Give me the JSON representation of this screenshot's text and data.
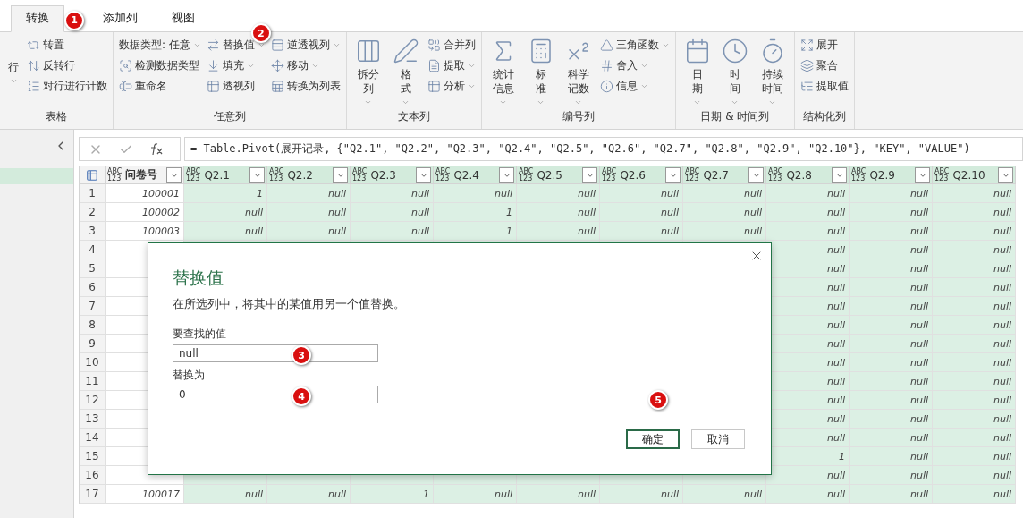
{
  "ribbon_tabs": [
    {
      "label": "转换",
      "selected": true,
      "marker": "1"
    },
    {
      "label": "添加列",
      "selected": false
    },
    {
      "label": "视图",
      "selected": false
    }
  ],
  "ribbon_groups": [
    {
      "label": "表格",
      "large": [
        {
          "label": "行",
          "dropdown": true
        }
      ],
      "columns": [
        [
          {
            "label": "转置",
            "dropdown": false
          },
          {
            "label": "反转行",
            "dropdown": false
          },
          {
            "label": "对行进行计数",
            "dropdown": false
          }
        ]
      ]
    },
    {
      "label": "任意列",
      "columns": [
        [
          {
            "label": "数据类型: 任意",
            "dropdown": true
          },
          {
            "label": "检测数据类型",
            "dropdown": false
          },
          {
            "label": "重命名",
            "dropdown": false
          }
        ],
        [
          {
            "label": "替换值",
            "dropdown": true,
            "marker": "2"
          },
          {
            "label": "填充",
            "dropdown": true
          },
          {
            "label": "透视列",
            "dropdown": false
          }
        ],
        [
          {
            "label": "逆透视列",
            "dropdown": true
          },
          {
            "label": "移动",
            "dropdown": true
          },
          {
            "label": "转换为列表",
            "dropdown": false
          }
        ]
      ]
    },
    {
      "label": "文本列",
      "large": [
        {
          "label": "拆分列",
          "dropdown": true
        },
        {
          "label": "格式",
          "dropdown": true
        }
      ],
      "columns": [
        [
          {
            "label": "合并列",
            "dropdown": false
          },
          {
            "label": "提取",
            "dropdown": true
          },
          {
            "label": "分析",
            "dropdown": true
          }
        ]
      ]
    },
    {
      "label": "编号列",
      "large": [
        {
          "label": "统计信息",
          "dropdown": true
        },
        {
          "label": "标准",
          "dropdown": true
        },
        {
          "label": "科学记数",
          "dropdown": true
        }
      ],
      "columns": [
        [
          {
            "label": "三角函数",
            "dropdown": true
          },
          {
            "label": "舍入",
            "dropdown": true
          },
          {
            "label": "信息",
            "dropdown": true
          }
        ]
      ]
    },
    {
      "label": "日期 & 时间列",
      "large": [
        {
          "label": "日期",
          "dropdown": true
        },
        {
          "label": "时间",
          "dropdown": true
        },
        {
          "label": "持续时间",
          "dropdown": true
        }
      ]
    },
    {
      "label": "结构化列",
      "columns": [
        [
          {
            "label": "展开",
            "dropdown": false
          },
          {
            "label": "聚合",
            "dropdown": false
          },
          {
            "label": "提取值",
            "dropdown": false
          }
        ]
      ]
    }
  ],
  "query_list": [
    {
      "selected": true
    }
  ],
  "formula": "= Table.Pivot(展开记录, {\"Q2.1\", \"Q2.2\", \"Q2.3\", \"Q2.4\", \"Q2.5\", \"Q2.6\", \"Q2.7\", \"Q2.8\", \"Q2.9\", \"Q2.10\"}, \"KEY\", \"VALUE\")",
  "table": {
    "columns": [
      {
        "name": "问卷号",
        "type": "ABC\n123",
        "highlighted": false
      },
      {
        "name": "Q2.1",
        "type": "ABC\n123",
        "highlighted": true
      },
      {
        "name": "Q2.2",
        "type": "ABC\n123",
        "highlighted": true
      },
      {
        "name": "Q2.3",
        "type": "ABC\n123",
        "highlighted": true
      },
      {
        "name": "Q2.4",
        "type": "ABC\n123",
        "highlighted": true
      },
      {
        "name": "Q2.5",
        "type": "ABC\n123",
        "highlighted": true
      },
      {
        "name": "Q2.6",
        "type": "ABC\n123",
        "highlighted": true
      },
      {
        "name": "Q2.7",
        "type": "ABC\n123",
        "highlighted": true
      },
      {
        "name": "Q2.8",
        "type": "ABC\n123",
        "highlighted": true
      },
      {
        "name": "Q2.9",
        "type": "ABC\n123",
        "highlighted": true
      },
      {
        "name": "Q2.10",
        "type": "ABC\n123",
        "highlighted": true
      }
    ],
    "rows": [
      {
        "number": "1",
        "covered": false,
        "cells": [
          "100001",
          "1",
          "null",
          "null",
          "null",
          "null",
          "null",
          "null",
          "null",
          "null",
          "null"
        ]
      },
      {
        "number": "2",
        "covered": false,
        "cells": [
          "100002",
          "null",
          "null",
          "null",
          "1",
          "null",
          "null",
          "null",
          "null",
          "null",
          "null"
        ]
      },
      {
        "number": "3",
        "covered": false,
        "cells": [
          "100003",
          "null",
          "null",
          "null",
          "1",
          "null",
          "null",
          "null",
          "null",
          "null",
          "null"
        ]
      },
      {
        "number": "4",
        "covered": true,
        "cells": [
          "null",
          "null",
          "null"
        ]
      },
      {
        "number": "5",
        "covered": true,
        "cells": [
          "null",
          "null",
          "null"
        ]
      },
      {
        "number": "6",
        "covered": true,
        "cells": [
          "null",
          "null",
          "null"
        ]
      },
      {
        "number": "7",
        "covered": true,
        "cells": [
          "null",
          "null",
          "null"
        ]
      },
      {
        "number": "8",
        "covered": true,
        "cells": [
          "null",
          "null",
          "null"
        ]
      },
      {
        "number": "9",
        "covered": true,
        "cells": [
          "null",
          "null",
          "null"
        ]
      },
      {
        "number": "10",
        "covered": true,
        "cells": [
          "null",
          "null",
          "null"
        ]
      },
      {
        "number": "11",
        "covered": true,
        "cells": [
          "null",
          "null",
          "null"
        ]
      },
      {
        "number": "12",
        "covered": true,
        "cells": [
          "null",
          "null",
          "null"
        ]
      },
      {
        "number": "13",
        "covered": true,
        "cells": [
          "null",
          "null",
          "null"
        ]
      },
      {
        "number": "14",
        "covered": true,
        "cells": [
          "null",
          "null",
          "null"
        ]
      },
      {
        "number": "15",
        "covered": true,
        "cells": [
          "1",
          "null",
          "null"
        ]
      },
      {
        "number": "16",
        "covered": true,
        "cells": [
          "null",
          "null",
          "null"
        ]
      },
      {
        "number": "17",
        "covered": false,
        "cells": [
          "100017",
          "null",
          "null",
          "1",
          "null",
          "null",
          "null",
          "null",
          "null",
          "null",
          "null"
        ]
      }
    ]
  },
  "dialog": {
    "title": "替换值",
    "description": "在所选列中，将其中的某值用另一个值替换。",
    "fields": [
      {
        "label": "要查找的值",
        "value": "null",
        "marker": "3"
      },
      {
        "label": "替换为",
        "value": "0",
        "marker": "4"
      }
    ],
    "marker": "5",
    "buttons": [
      {
        "label": "确定",
        "primary": true
      },
      {
        "label": "取消",
        "primary": false
      }
    ]
  }
}
